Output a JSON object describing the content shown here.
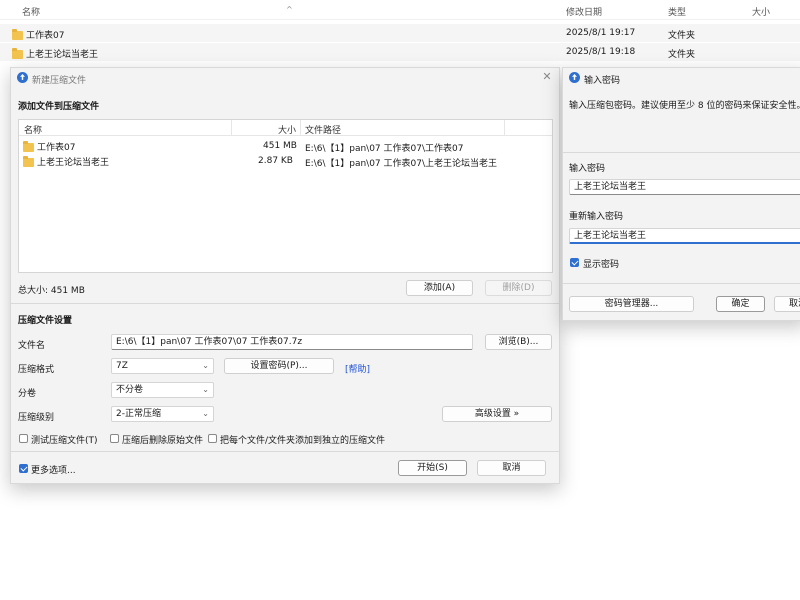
{
  "explorer": {
    "columns": {
      "name": "名称",
      "modified": "修改日期",
      "type": "类型",
      "size": "大小"
    },
    "rows": [
      {
        "name": "工作表07",
        "modified": "2025/8/1 19:17",
        "type": "文件夹"
      },
      {
        "name": "上老王论坛当老王",
        "modified": "2025/8/1 19:18",
        "type": "文件夹"
      }
    ]
  },
  "archive_dialog": {
    "title": "新建压缩文件",
    "add_section_title": "添加文件到压缩文件",
    "list_columns": {
      "name": "名称",
      "size": "大小",
      "path": "文件路径"
    },
    "files": [
      {
        "name": "工作表07",
        "size": "451 MB",
        "path": "E:\\6\\【1】pan\\07 工作表07\\工作表07"
      },
      {
        "name": "上老王论坛当老王",
        "size": "2.87 KB",
        "path": "E:\\6\\【1】pan\\07 工作表07\\上老王论坛当老王"
      }
    ],
    "total_size": "总大小: 451 MB",
    "add_button": "添加(A)",
    "delete_button": "删除(D)",
    "settings_title": "压缩文件设置",
    "filename_label": "文件名",
    "filename_value": "E:\\6\\【1】pan\\07 工作表07\\07 工作表07.7z",
    "browse_button": "浏览(B)...",
    "format_label": "压缩格式",
    "format_value": "7Z",
    "set_password_button": "设置密码(P)...",
    "help_link": "[帮助]",
    "split_label": "分卷",
    "split_value": "不分卷",
    "level_label": "压缩级别",
    "level_value": "2-正常压缩",
    "advanced_button": "高级设置 »",
    "test_archive": "测试压缩文件(T)",
    "delete_source": "压缩后删除原始文件",
    "separate_archives": "把每个文件/文件夹添加到独立的压缩文件",
    "more_options": "更多选项...",
    "start_button": "开始(S)",
    "cancel_button": "取消"
  },
  "password_dialog": {
    "title": "输入密码",
    "instruction": "输入压缩包密码。建议使用至少 8 位的密码来保证安全性。",
    "password_label": "输入密码",
    "password_value": "上老王论坛当老王",
    "confirm_label": "重新输入密码",
    "confirm_value": "上老王论坛当老王",
    "show_password": "显示密码",
    "manager_button": "密码管理器...",
    "ok_button": "确定",
    "cancel_button": "取消"
  },
  "colors": {
    "accent": "#2f6fd0",
    "folder": "#f2c34e",
    "link": "#1c4fd6"
  }
}
